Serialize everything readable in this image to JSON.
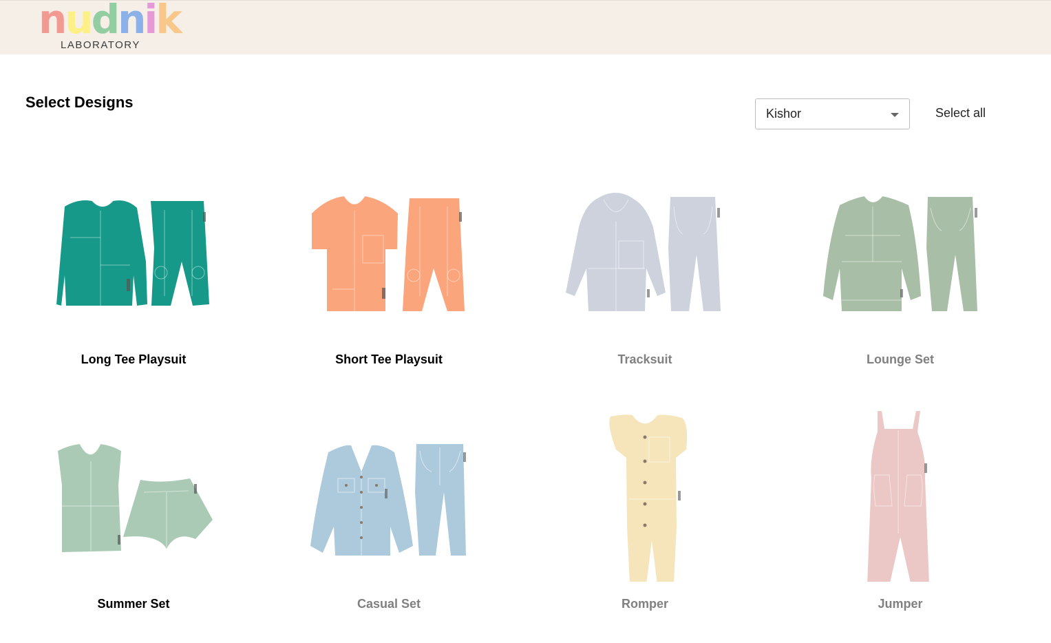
{
  "header": {
    "logo": {
      "letters": [
        {
          "char": "n",
          "color": "#f28b82"
        },
        {
          "char": "u",
          "color": "#fff176"
        },
        {
          "char": "d",
          "color": "#81c995"
        },
        {
          "char": "n",
          "color": "#7aa7e8"
        },
        {
          "char": "i",
          "color": "#e38bd4"
        },
        {
          "char": "k",
          "color": "#f9c27a"
        }
      ],
      "subtitle": "LABORATORY"
    }
  },
  "main": {
    "title": "Select Designs",
    "filter": {
      "selected": "Kishor"
    },
    "select_all_label": "Select all",
    "designs": [
      {
        "label": "Long Tee Playsuit",
        "selected": true,
        "color": "#17998a",
        "garment": "long-tee-pants"
      },
      {
        "label": "Short Tee Playsuit",
        "selected": true,
        "color": "#fba57c",
        "garment": "short-tee-pants"
      },
      {
        "label": "Tracksuit",
        "selected": false,
        "color": "#cdd2dc",
        "garment": "hoodie-pants"
      },
      {
        "label": "Lounge Set",
        "selected": false,
        "color": "#a9bea7",
        "garment": "sweater-joggers"
      },
      {
        "label": "Summer Set",
        "selected": true,
        "color": "#aacab5",
        "garment": "tank-shorts"
      },
      {
        "label": "Casual Set",
        "selected": false,
        "color": "#adcadd",
        "garment": "shirt-jeans"
      },
      {
        "label": "Romper",
        "selected": false,
        "color": "#f6e4bb",
        "garment": "romper"
      },
      {
        "label": "Jumper",
        "selected": false,
        "color": "#ebc7c5",
        "garment": "overalls"
      }
    ]
  }
}
